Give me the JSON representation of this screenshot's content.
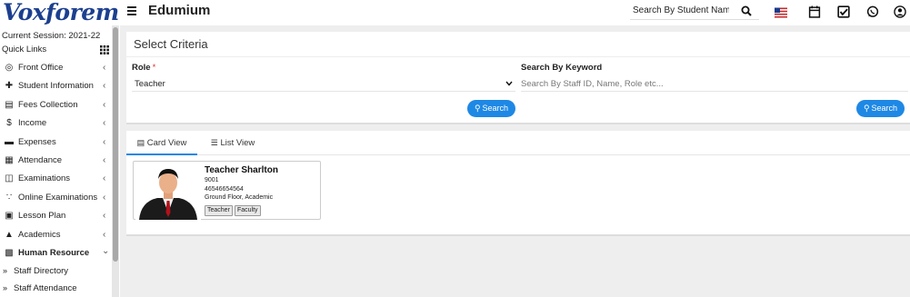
{
  "header": {
    "logo": "Voxforem",
    "brand": "Edumium",
    "search_placeholder": "Search By Student Name",
    "icons": [
      "search-icon",
      "us-flag-icon",
      "calendar-icon",
      "task-check-icon",
      "whatsapp-icon",
      "user-avatar-icon"
    ]
  },
  "sidebar": {
    "session": "Current Session: 2021-22",
    "quick_links": "Quick Links",
    "items": [
      {
        "label": "Front Office",
        "icon": "front-office-icon"
      },
      {
        "label": "Student Information",
        "icon": "student-info-icon"
      },
      {
        "label": "Fees Collection",
        "icon": "fees-icon"
      },
      {
        "label": "Income",
        "icon": "dollar-icon"
      },
      {
        "label": "Expenses",
        "icon": "credit-card-icon"
      },
      {
        "label": "Attendance",
        "icon": "calendar-check-icon"
      },
      {
        "label": "Examinations",
        "icon": "map-icon"
      },
      {
        "label": "Online Examinations",
        "icon": "rss-icon"
      },
      {
        "label": "Lesson Plan",
        "icon": "lesson-plan-icon"
      },
      {
        "label": "Academics",
        "icon": "graduation-cap-icon"
      },
      {
        "label": "Human Resource",
        "icon": "sitemap-icon"
      }
    ],
    "sub_items": [
      {
        "label": "Staff Directory"
      },
      {
        "label": "Staff Attendance"
      }
    ]
  },
  "criteria": {
    "title": "Select Criteria",
    "role_label": "Role",
    "role_required": "*",
    "role_value": "Teacher",
    "keyword_label": "Search By Keyword",
    "keyword_placeholder": "Search By Staff ID, Name, Role etc...",
    "search_button": "Search",
    "search_button_2": "Search"
  },
  "results": {
    "tabs": [
      {
        "label": "Card View",
        "active": true
      },
      {
        "label": "List View",
        "active": false
      }
    ],
    "cards": [
      {
        "name": "Teacher Sharlton",
        "staff_id": "9001",
        "phone": "46546654564",
        "location": "Ground Floor, Academic",
        "tags": [
          "Teacher",
          "Faculty"
        ]
      }
    ]
  },
  "colors": {
    "accent": "#1e88e5",
    "logo": "#1c3f8f",
    "background": "#eeeeee"
  }
}
